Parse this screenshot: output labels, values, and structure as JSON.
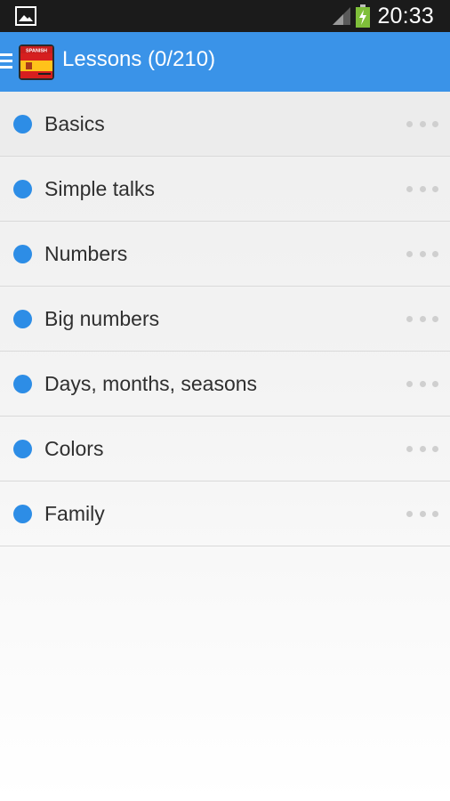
{
  "status_bar": {
    "time": "20:33",
    "left_icon": "gallery-icon",
    "signal_icon": "signal-icon",
    "battery_icon": "battery-charging-icon"
  },
  "action_bar": {
    "menu_icon": "menu-icon",
    "logo_icon": "spain-flag-icon",
    "logo_text": "SPANISH",
    "title": "Lessons (0/210)",
    "background_color": "#3a93e8"
  },
  "lessons": [
    {
      "label": "Basics"
    },
    {
      "label": "Simple talks"
    },
    {
      "label": "Numbers"
    },
    {
      "label": "Big numbers"
    },
    {
      "label": "Days, months, seasons"
    },
    {
      "label": "Colors"
    },
    {
      "label": "Family"
    }
  ],
  "colors": {
    "dot": "#2d8de6",
    "more_dots": "#cfcfcf"
  }
}
